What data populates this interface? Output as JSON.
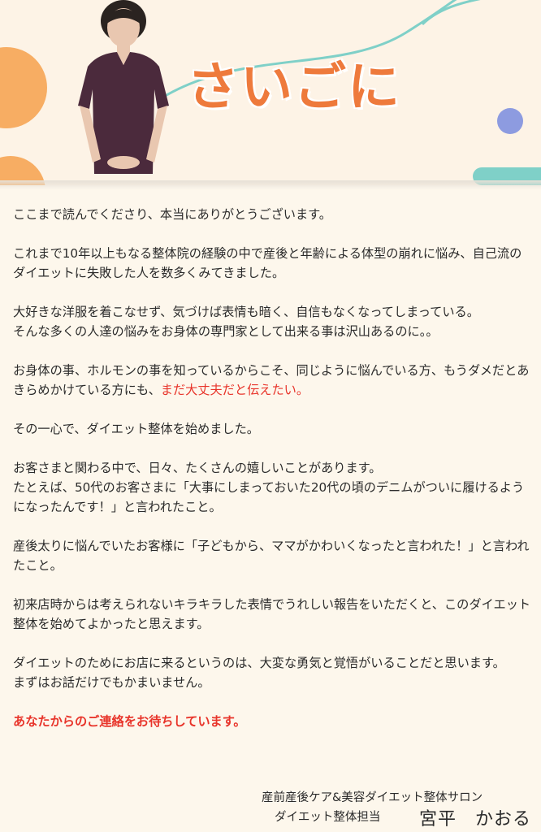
{
  "header": {
    "title": "さいごに",
    "colors": {
      "title": "#ee7a3c",
      "accent_orange": "#f7ad63",
      "accent_teal": "#7fd0c8",
      "accent_blue": "#8d9be0"
    }
  },
  "body": {
    "p1": "ここまで読んでくださり、本当にありがとうございます。",
    "p2": "これまで10年以上もなる整体院の経験の中で産後と年齢による体型の崩れに悩み、自己流のダイエットに失敗した人を数多くみてきました。",
    "p3": "大好きな洋服を着こなせず、気づけば表情も暗く、自信もなくなってしまっている。\nそんな多くの人達の悩みをお身体の専門家として出来る事は沢山あるのに。。",
    "p4_a": "お身体の事、ホルモンの事を知っているからこそ、同じように悩んでいる方、もうダメだとあきらめかけている方にも、",
    "p4_red": "まだ大丈夫だと伝えたい。",
    "p5": "その一心で、ダイエット整体を始めました。",
    "p6": "お客さまと関わる中で、日々、たくさんの嬉しいことがあります。\nたとえば、50代のお客さまに「大事にしまっておいた20代の頃のデニムがついに履けるようになったんです！」と言われたこと。",
    "p7": "産後太りに悩んでいたお客様に「子どもから、ママがかわいくなったと言われた！」と言われたこと。",
    "p8": "初来店時からは考えられないキラキラした表情でうれしい報告をいただくと、このダイエット整体を始めてよかったと思えます。",
    "p9": "ダイエットのためにお店に来るというのは、大変な勇気と覚悟がいることだと思います。\nまずはお話だけでもかまいません。",
    "closing": "あなたからのご連絡をお待ちしています。",
    "red_color": "#e8342a"
  },
  "signature": {
    "line1": "産前産後ケア&美容ダイエット整体サロン",
    "line2": "ダイエット整体担当",
    "name": "宮平　かおる"
  }
}
